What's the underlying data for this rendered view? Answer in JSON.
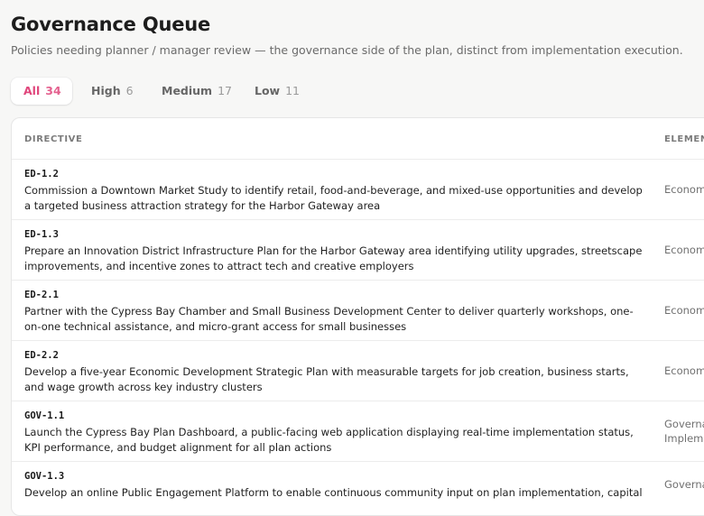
{
  "header": {
    "title": "Governance Queue",
    "subtitle": "Policies needing planner / manager review — the governance side of the plan, distinct from implementation execution."
  },
  "tabs": [
    {
      "label": "All",
      "count": "34",
      "active": true
    },
    {
      "label": "High",
      "count": "6",
      "active": false
    },
    {
      "label": "Medium",
      "count": "17",
      "active": false
    },
    {
      "label": "Low",
      "count": "11",
      "active": false
    }
  ],
  "table": {
    "columns": [
      "DIRECTIVE",
      "ELEMEN"
    ],
    "rows": [
      {
        "code": "ED-1.2",
        "description": "Commission a Downtown Market Study to identify retail, food-and-beverage, and mixed-use opportunities and develop a targeted business attraction strategy for the Harbor Gateway area",
        "element": "Econom"
      },
      {
        "code": "ED-1.3",
        "description": "Prepare an Innovation District Infrastructure Plan for the Harbor Gateway area identifying utility upgrades, streetscape improvements, and incentive zones to attract tech and creative employers",
        "element": "Econom"
      },
      {
        "code": "ED-2.1",
        "description": "Partner with the Cypress Bay Chamber and Small Business Development Center to deliver quarterly workshops, one-on-one technical assistance, and micro-grant access for small businesses",
        "element": "Econom"
      },
      {
        "code": "ED-2.2",
        "description": "Develop a five-year Economic Development Strategic Plan with measurable targets for job creation, business starts, and wage growth across key industry clusters",
        "element": "Econom"
      },
      {
        "code": "GOV-1.1",
        "description": "Launch the Cypress Bay Plan Dashboard, a public-facing web application displaying real-time implementation status, KPI performance, and budget alignment for all plan actions",
        "element": "Governa Impleme"
      },
      {
        "code": "GOV-1.3",
        "description": "Develop an online Public Engagement Platform to enable continuous community input on plan implementation, capital",
        "element": "Governa"
      }
    ]
  },
  "colors": {
    "accent": "#e0457b",
    "background": "#f7f7f6",
    "card": "#ffffff",
    "muted_text": "#6b6b6b"
  }
}
